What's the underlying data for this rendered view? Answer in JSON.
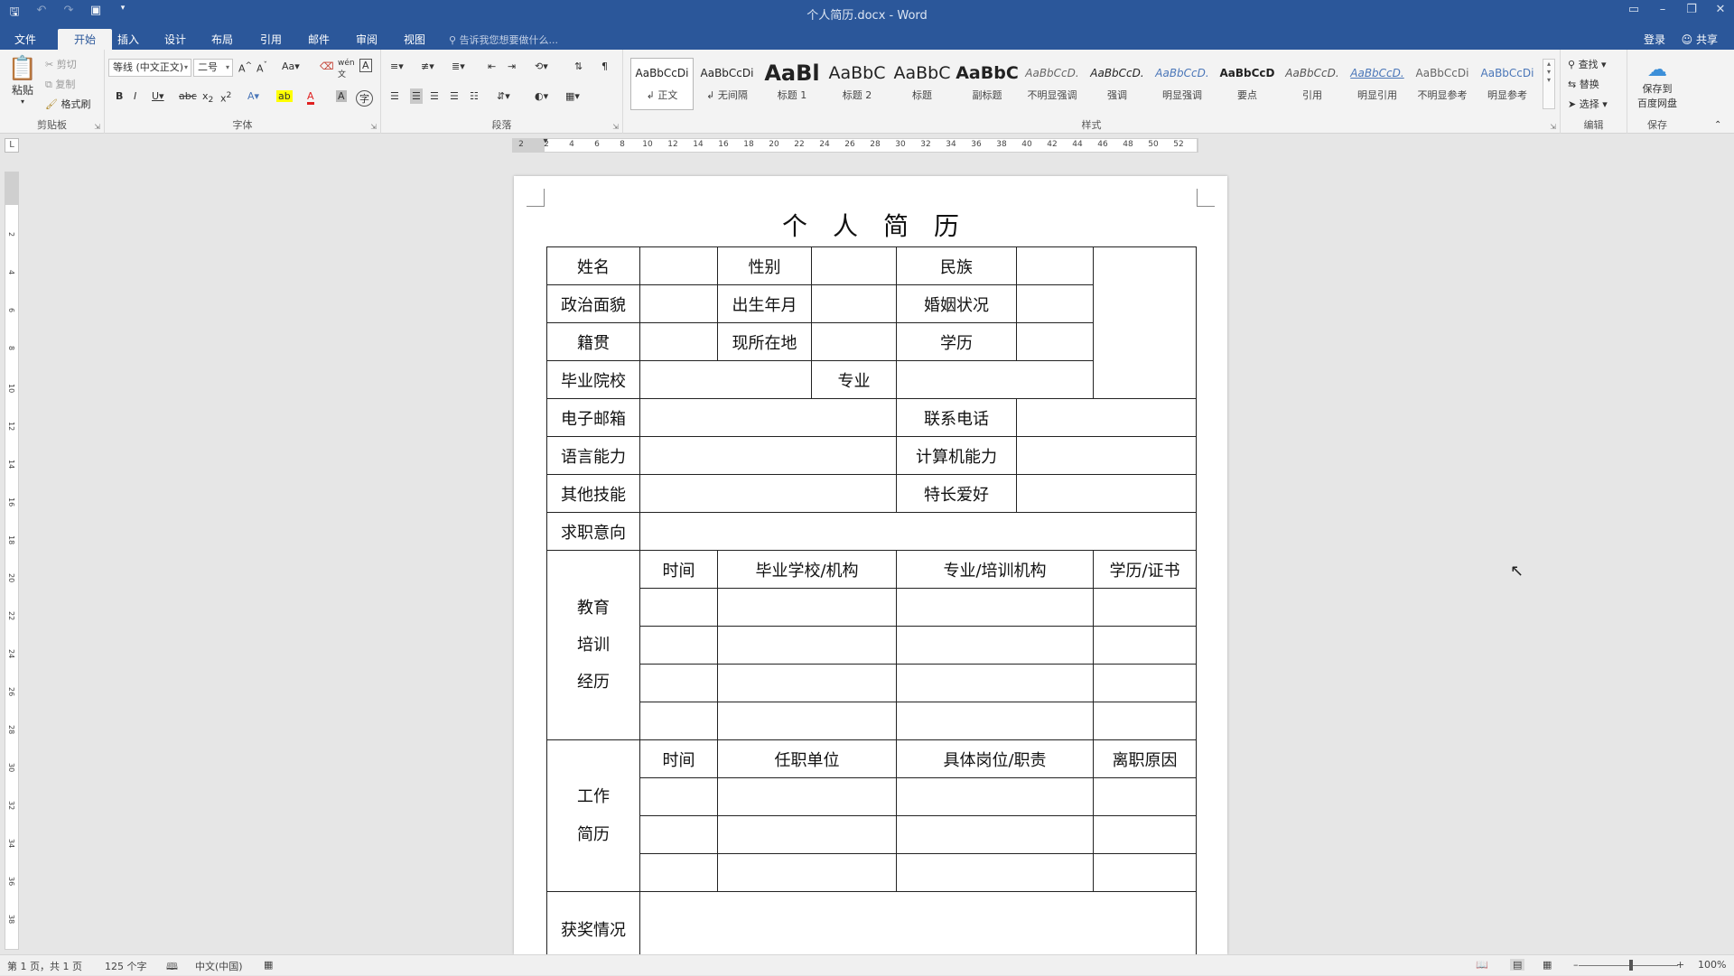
{
  "window": {
    "title": "个人简历.docx - Word",
    "quick_access": [
      "save-icon",
      "undo-icon",
      "redo-icon",
      "print-preview-icon",
      "customize-icon"
    ],
    "controls": [
      "ribbon-display-icon",
      "minimize-icon",
      "restore-icon",
      "close-icon"
    ]
  },
  "tabs": [
    "文件",
    "开始",
    "插入",
    "设计",
    "布局",
    "引用",
    "邮件",
    "审阅",
    "视图"
  ],
  "active_tab": "开始",
  "tell_me": "告诉我您想要做什么...",
  "account": {
    "signin": "登录",
    "share": "共享"
  },
  "ribbon": {
    "clipboard": {
      "paste": "粘贴",
      "cut": "剪切",
      "copy": "复制",
      "format_painter": "格式刷",
      "label": "剪贴板"
    },
    "font": {
      "name": "等线 (中文正文)",
      "size": "二号",
      "label": "字体"
    },
    "paragraph": {
      "label": "段落"
    },
    "styles": {
      "label": "样式",
      "items": [
        {
          "preview": "AaBbCcDi",
          "name": "↲ 正文"
        },
        {
          "preview": "AaBbCcDi",
          "name": "↲ 无间隔"
        },
        {
          "preview": "AaBl",
          "name": "标题 1"
        },
        {
          "preview": "AaBbC",
          "name": "标题 2"
        },
        {
          "preview": "AaBbC",
          "name": "标题"
        },
        {
          "preview": "AaBbC",
          "name": "副标题"
        },
        {
          "preview": "AaBbCcD.",
          "name": "不明显强调"
        },
        {
          "preview": "AaBbCcD.",
          "name": "强调"
        },
        {
          "preview": "AaBbCcD.",
          "name": "明显强调"
        },
        {
          "preview": "AaBbCcD",
          "name": "要点"
        },
        {
          "preview": "AaBbCcD.",
          "name": "引用"
        },
        {
          "preview": "AaBbCcD.",
          "name": "明显引用"
        },
        {
          "preview": "AaBbCcDi",
          "name": "不明显参考"
        },
        {
          "preview": "AaBbCcDi",
          "name": "明显参考"
        }
      ]
    },
    "editing": {
      "find": "查找",
      "replace": "替换",
      "select": "选择",
      "label": "编辑"
    },
    "save": {
      "line1": "保存到",
      "line2": "百度网盘",
      "label": "保存"
    }
  },
  "ruler_h": [
    "2",
    "2",
    "4",
    "6",
    "8",
    "10",
    "12",
    "14",
    "16",
    "18",
    "20",
    "22",
    "24",
    "26",
    "28",
    "30",
    "32",
    "34",
    "36",
    "38",
    "40",
    "42",
    "44",
    "46",
    "48",
    "50",
    "52"
  ],
  "ruler_v": [
    "2",
    "4",
    "6",
    "8",
    "10",
    "12",
    "14",
    "16",
    "18",
    "20",
    "22",
    "24",
    "26",
    "28",
    "30",
    "32",
    "34",
    "36",
    "38"
  ],
  "document": {
    "heading": [
      "个",
      "人",
      "简",
      "历"
    ],
    "rows": {
      "r1": [
        "姓名",
        "",
        "性别",
        "",
        "民族",
        ""
      ],
      "r2": [
        "政治面貌",
        "",
        "出生年月",
        "",
        "婚姻状况",
        ""
      ],
      "r3": [
        "籍贯",
        "",
        "现所在地",
        "",
        "学历",
        ""
      ],
      "r4": [
        "毕业院校",
        "",
        "专业",
        ""
      ],
      "r5": [
        "电子邮箱",
        "",
        "联系电话",
        ""
      ],
      "r6": [
        "语言能力",
        "",
        "计算机能力",
        ""
      ],
      "r7": [
        "其他技能",
        "",
        "特长爱好",
        ""
      ],
      "r8": [
        "求职意向",
        ""
      ]
    },
    "education": {
      "label": [
        "教育",
        "培训",
        "经历"
      ],
      "headers": [
        "时间",
        "毕业学校/机构",
        "专业/培训机构",
        "学历/证书"
      ]
    },
    "work": {
      "label": [
        "工作",
        "简历"
      ],
      "headers": [
        "时间",
        "任职单位",
        "具体岗位/职责",
        "离职原因"
      ]
    },
    "awards": "获奖情况"
  },
  "status": {
    "page": "第 1 页，共 1 页",
    "words": "125 个字",
    "lang": "中文(中国)",
    "zoom": "100%"
  }
}
